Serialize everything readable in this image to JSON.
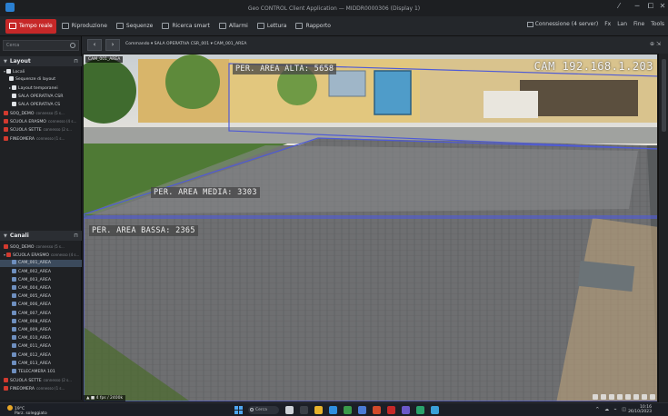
{
  "window": {
    "title": "Geo CONTROL Client Application — MIDDR0000306 (Display 1)",
    "controls": [
      "⁄",
      "─",
      "⧠",
      "✕"
    ]
  },
  "toolbar": {
    "items": [
      {
        "label": "Tempo reale",
        "icon": "live-icon",
        "active": true
      },
      {
        "label": "Riproduzione",
        "icon": "playback-icon",
        "active": false
      },
      {
        "label": "Sequenze",
        "icon": "sequence-icon",
        "active": false
      },
      {
        "label": "Ricerca smart",
        "icon": "smart-search-icon",
        "active": false
      },
      {
        "label": "Allarmi",
        "icon": "alarm-icon",
        "active": false
      },
      {
        "label": "Lettura",
        "icon": "lettura-icon",
        "active": false
      },
      {
        "label": "Rapporto",
        "icon": "report-icon",
        "active": false
      }
    ],
    "connection": "Connessione (4 server)",
    "right_labels": [
      "Fx",
      "Lan",
      "Fine",
      "Tools"
    ]
  },
  "left_panel": {
    "search_placeholder": "Cerca",
    "layouts": {
      "header": "Layout",
      "items": [
        {
          "label": "Locali",
          "icon": "white",
          "indent": 0,
          "arrow": "▾"
        },
        {
          "label": "Sequenze di layout",
          "icon": "white",
          "indent": 2,
          "arrow": ""
        },
        {
          "label": "Layout temporanei",
          "icon": "white",
          "indent": 2,
          "arrow": "▸"
        },
        {
          "label": "SALA OPERATIVA CSR",
          "icon": "white",
          "indent": 3,
          "arrow": ""
        },
        {
          "label": "SALA OPERATIVA CS",
          "icon": "white",
          "indent": 3,
          "arrow": ""
        },
        {
          "label": "SOQ_DEMO",
          "sub": "connesso (5 s...",
          "icon": "red",
          "indent": 0,
          "arrow": ""
        },
        {
          "label": "SCUOLA ERASMO",
          "sub": "connesso (4 s...",
          "icon": "red",
          "indent": 0,
          "arrow": ""
        },
        {
          "label": "SCUOLA SETTE",
          "sub": "connesso (2 s...",
          "icon": "red",
          "indent": 0,
          "arrow": ""
        },
        {
          "label": "FINEOMERA",
          "sub": "connesso (1 s...",
          "icon": "red",
          "indent": 0,
          "arrow": ""
        }
      ]
    },
    "devices": {
      "header": "Canali",
      "items": [
        {
          "label": "SOQ_DEMO",
          "sub": "connesso (5 s...",
          "icon": "red",
          "indent": 0,
          "arrow": "",
          "selected": false
        },
        {
          "label": "SCUOLA ERASMO",
          "sub": "connesso (4 s...",
          "icon": "red",
          "indent": 0,
          "arrow": "▾",
          "selected": false
        },
        {
          "label": "CAM_001_AREA",
          "icon": "blue",
          "indent": 3,
          "arrow": "",
          "selected": true
        },
        {
          "label": "CAM_002_AREA",
          "icon": "blue",
          "indent": 3,
          "arrow": "",
          "selected": false
        },
        {
          "label": "CAM_003_AREA",
          "icon": "blue",
          "indent": 3,
          "arrow": "",
          "selected": false
        },
        {
          "label": "CAM_004_AREA",
          "icon": "blue",
          "indent": 3,
          "arrow": "",
          "selected": false
        },
        {
          "label": "CAM_005_AREA",
          "icon": "blue",
          "indent": 3,
          "arrow": "",
          "selected": false
        },
        {
          "label": "CAM_006_AREA",
          "icon": "blue",
          "indent": 3,
          "arrow": "",
          "selected": false
        },
        {
          "label": "CAM_007_AREA",
          "icon": "blue",
          "indent": 3,
          "arrow": "",
          "selected": false
        },
        {
          "label": "CAM_008_AREA",
          "icon": "blue",
          "indent": 3,
          "arrow": "",
          "selected": false
        },
        {
          "label": "CAM_009_AREA",
          "icon": "blue",
          "indent": 3,
          "arrow": "",
          "selected": false
        },
        {
          "label": "CAM_010_AREA",
          "icon": "blue",
          "indent": 3,
          "arrow": "",
          "selected": false
        },
        {
          "label": "CAM_011_AREA",
          "icon": "blue",
          "indent": 3,
          "arrow": "",
          "selected": false
        },
        {
          "label": "CAM_012_AREA",
          "icon": "blue",
          "indent": 3,
          "arrow": "",
          "selected": false
        },
        {
          "label": "CAM_013_AREA",
          "icon": "blue",
          "indent": 3,
          "arrow": "",
          "selected": false
        },
        {
          "label": "TELECAMERA 101",
          "icon": "blue",
          "indent": 3,
          "arrow": "",
          "selected": false
        },
        {
          "label": "SCUOLA SETTE",
          "sub": "connesso (2 s...",
          "icon": "red",
          "indent": 0,
          "arrow": "",
          "selected": false
        },
        {
          "label": "FINEOMERA",
          "sub": "connesso (1 s...",
          "icon": "red",
          "indent": 0,
          "arrow": "",
          "selected": false
        }
      ]
    }
  },
  "navbar": {
    "back": "‹",
    "forward": "›",
    "breadcrumb": "Commando ▾ SALA OPERATIVA CSR_001 ▾ CAM_001_AREA",
    "right": "⊕ ⇲"
  },
  "camera": {
    "tag": "CAM_001_AREA",
    "ip": "CAM 192.168.1.203",
    "area_labels": {
      "alta": "PER. AREA ALTA: 5658",
      "media": "PER. AREA MEDIA: 3303",
      "bassa": "PER. AREA BASSA: 2365"
    },
    "footer": "▲ ■ 4 fps / 2400k",
    "zone_color": "#4f5bd5"
  },
  "taskbar": {
    "weather_temp": "19°C",
    "weather_desc": "Parz. soleggiato",
    "search": "Cerca",
    "time": "10:16",
    "date": "26/10/2023",
    "tray": "^ ☁ ⌁ ◫"
  }
}
